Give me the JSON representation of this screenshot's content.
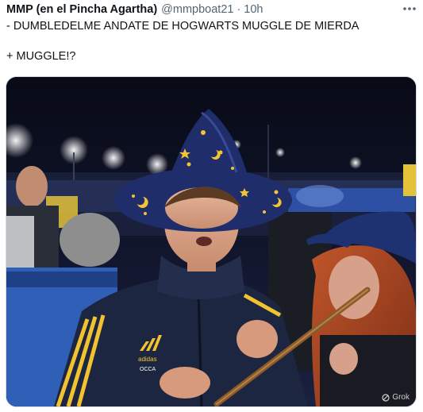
{
  "tweet": {
    "author_name": "MMP (en el Pincha Agartha)",
    "author_handle": "@mmpboat21",
    "separator": "·",
    "timestamp": "10h",
    "more_icon": "more-horizontal-icon",
    "text_lines": [
      "- DUMBLEDELME ANDATE DE HOGWARTS MUGGLE DE MIERDA",
      "+ MUGGLE!?"
    ]
  },
  "media": {
    "description_icon": "video-still-image",
    "watermark_label": "Grok",
    "shirt_badge": "adidas",
    "shirt_text": "OCCA",
    "colors": {
      "hat": "#1f2d6b",
      "hat_stars": "#f3c431",
      "jacket": "#1d2640",
      "jacket_stripes": "#f2c230",
      "stadium_night": "#0b0e1e",
      "crowd_blue": "#2f57b8",
      "wand": "#8a5a2b"
    }
  }
}
